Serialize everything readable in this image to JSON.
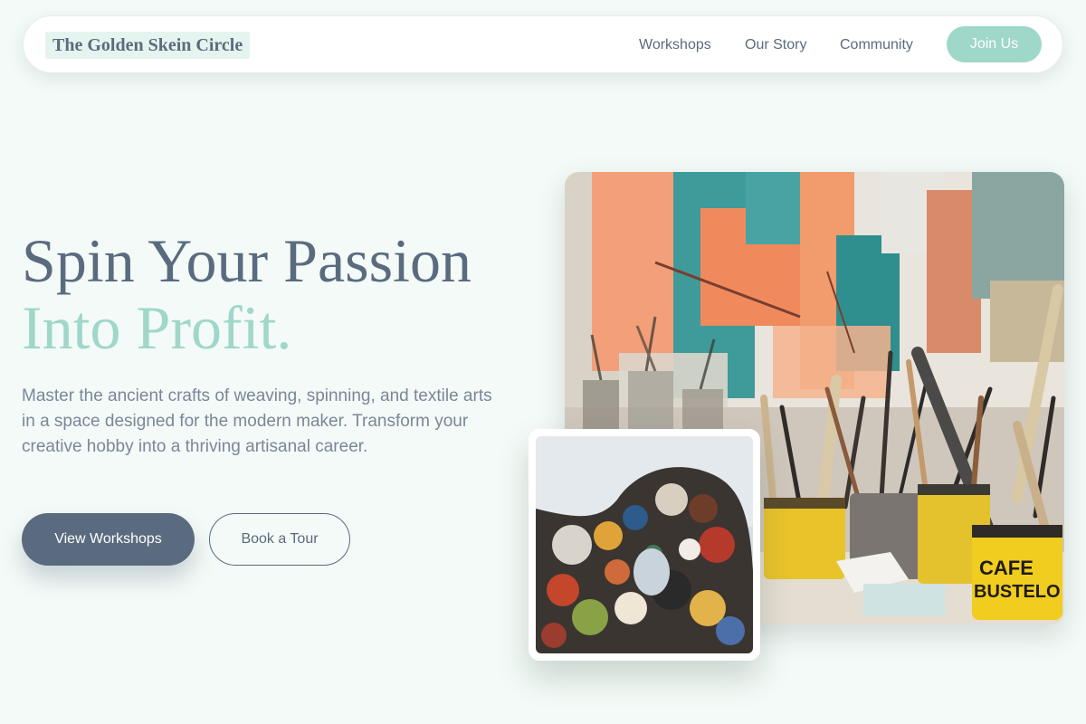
{
  "nav": {
    "logo": "The Golden Skein Circle",
    "links": [
      "Workshops",
      "Our Story",
      "Community"
    ],
    "cta": "Join Us"
  },
  "hero": {
    "headline": "Spin Your Passion",
    "headline_accent": "Into Profit.",
    "description": "Master the ancient crafts of weaving, spinning, and textile arts in a space designed for the modern maker. Transform your creative hobby into a thriving artisanal career.",
    "primary_button": "View Workshops",
    "secondary_button": "Book a Tour"
  },
  "images": {
    "main": "art-studio-brushes-in-cans",
    "inset": "paint-palette-with-thumb-hole",
    "can_label_top": "CAFE",
    "can_label_bottom": "BUSTELO"
  },
  "colors": {
    "background": "#f3faf7",
    "primary": "#5b6b7f",
    "accent": "#9fd7c9"
  }
}
